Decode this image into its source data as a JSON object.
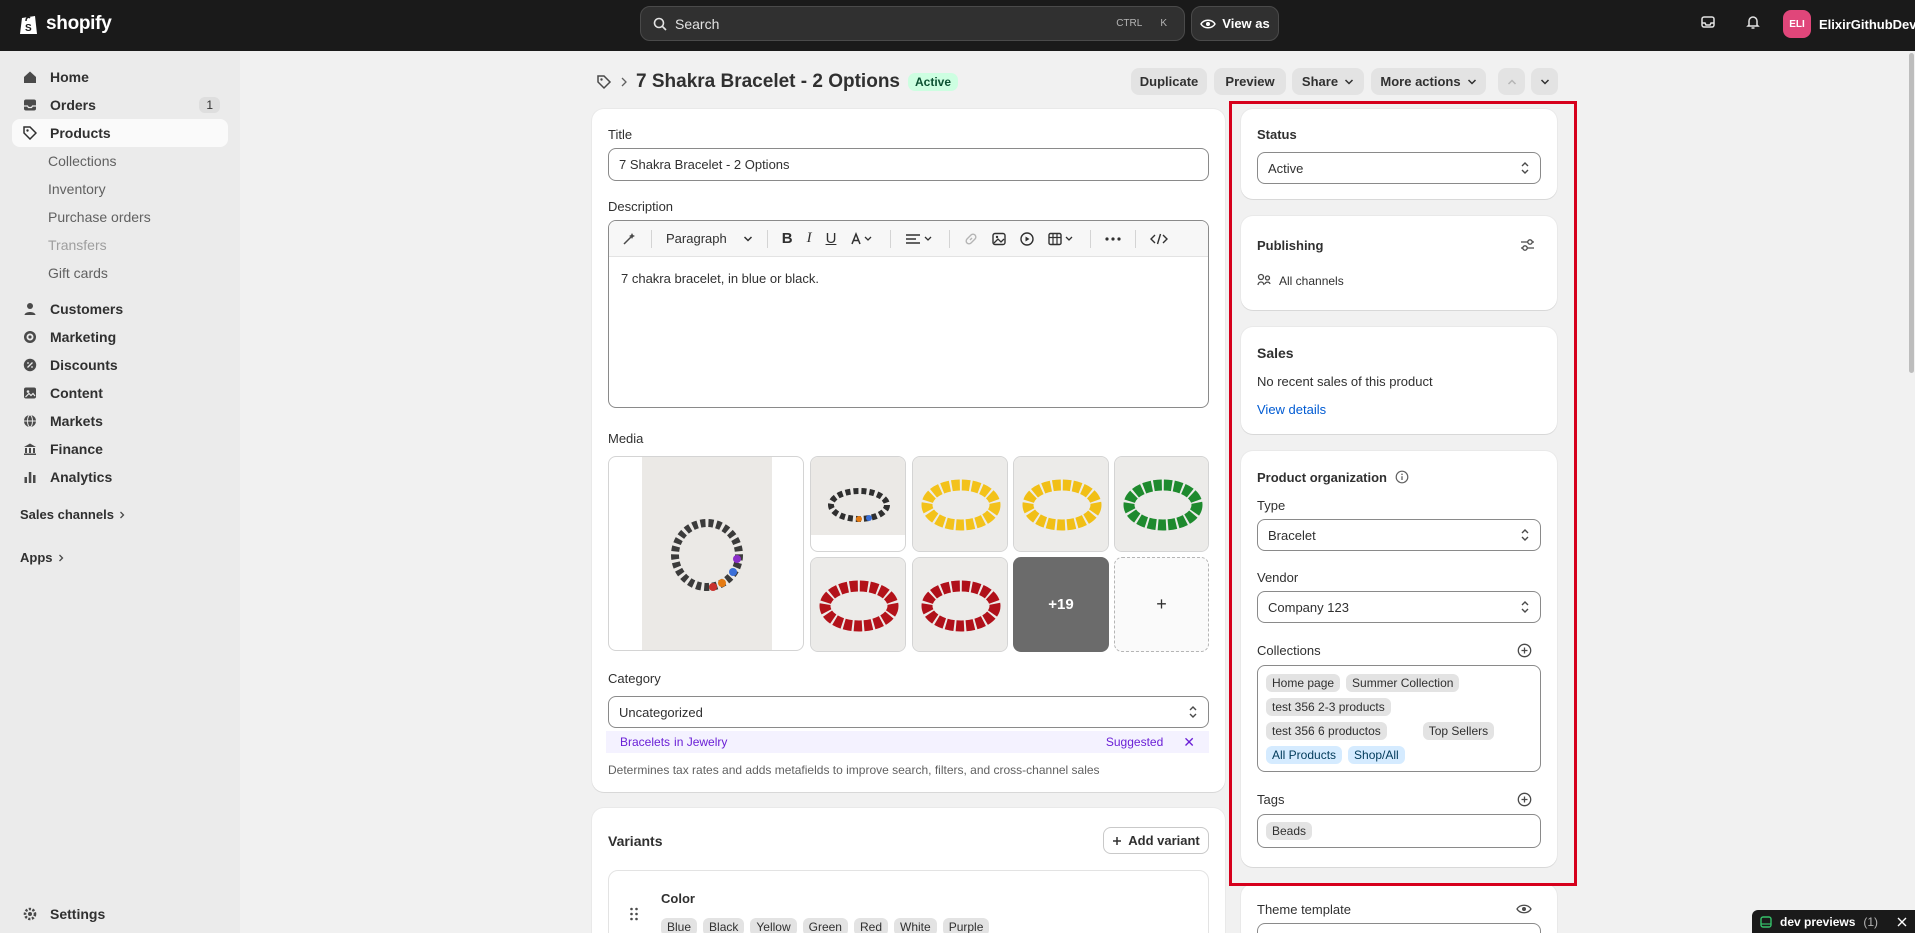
{
  "topbar": {
    "brand": "shopify",
    "search_placeholder": "Search",
    "shortcut_ctrl": "CTRL",
    "shortcut_key": "K",
    "view_as": "View as",
    "store_initials": "ELI",
    "store_name": "ElixirGithubDev"
  },
  "sidebar": {
    "home": "Home",
    "orders": "Orders",
    "orders_count": "1",
    "products": "Products",
    "collections": "Collections",
    "inventory": "Inventory",
    "purchase_orders": "Purchase orders",
    "transfers": "Transfers",
    "gift_cards": "Gift cards",
    "customers": "Customers",
    "marketing": "Marketing",
    "discounts": "Discounts",
    "content": "Content",
    "markets": "Markets",
    "finance": "Finance",
    "analytics": "Analytics",
    "sales_channels": "Sales channels",
    "apps": "Apps",
    "settings": "Settings"
  },
  "header": {
    "title": "7 Shakra Bracelet - 2 Options",
    "status_badge": "Active",
    "duplicate": "Duplicate",
    "preview": "Preview",
    "share": "Share",
    "more_actions": "More actions"
  },
  "product": {
    "title_label": "Title",
    "title_value": "7 Shakra Bracelet - 2 Options",
    "description_label": "Description",
    "paragraph": "Paragraph",
    "description_text": "7 chakra bracelet, in blue or black.",
    "media_label": "Media",
    "media_more": "+19",
    "media_add": "+",
    "category_label": "Category",
    "category_value": "Uncategorized",
    "suggest_name": "Bracelets",
    "suggest_in": "in Jewelry",
    "suggest_tag": "Suggested",
    "category_help": "Determines tax rates and adds metafields to improve search, filters, and cross-channel sales"
  },
  "variants": {
    "heading": "Variants",
    "add_variant": "Add variant",
    "option_name": "Color",
    "values": [
      "Blue",
      "Black",
      "Yellow",
      "Green",
      "Red",
      "White",
      "Purple"
    ]
  },
  "status_card": {
    "heading": "Status",
    "value": "Active"
  },
  "publishing": {
    "heading": "Publishing",
    "channels": "All channels"
  },
  "sales": {
    "heading": "Sales",
    "text": "No recent sales of this product",
    "link": "View details"
  },
  "organization": {
    "heading": "Product organization",
    "type_label": "Type",
    "type_value": "Bracelet",
    "vendor_label": "Vendor",
    "vendor_value": "Company 123",
    "collections_label": "Collections",
    "collections": [
      "Home page",
      "Summer Collection",
      "test 356 2-3 products",
      "test 356 6 productos",
      "Top Sellers",
      "All Products",
      "Shop/All"
    ],
    "tags_label": "Tags",
    "tags": [
      "Beads"
    ]
  },
  "theme": {
    "heading": "Theme template"
  },
  "devbar": {
    "label": "dev previews",
    "count": "(1)"
  }
}
